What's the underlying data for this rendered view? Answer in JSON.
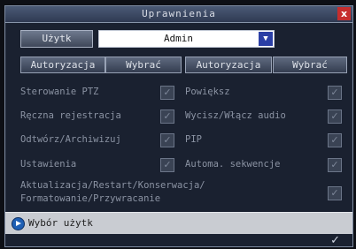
{
  "title": "Uprawnienia",
  "close_label": "x",
  "user": {
    "button_label": "Użytk",
    "selected": "Admin",
    "dropdown_arrow": "▼"
  },
  "header_buttons": [
    "Autoryzacja",
    "Wybrać",
    "Autoryzacja",
    "Wybrać"
  ],
  "permissions_left": [
    {
      "label": "Sterowanie PTZ",
      "checked": true
    },
    {
      "label": "Ręczna rejestracja",
      "checked": true
    },
    {
      "label": "Odtwórz/Archiwizuj",
      "checked": true
    },
    {
      "label": "Ustawienia",
      "checked": true
    }
  ],
  "permissions_right": [
    {
      "label": "Powiększ",
      "checked": true
    },
    {
      "label": "Wycisz/Włącz audio",
      "checked": true
    },
    {
      "label": "PIP",
      "checked": true
    },
    {
      "label": "Automa. sekwencje",
      "checked": true
    }
  ],
  "maintenance": {
    "line1": "Aktualizacja/Restart/Konserwacja/",
    "line2": "Formatowanie/Przywracanie",
    "checked": true
  },
  "checkmark": "✓",
  "status": {
    "text": "Wybór użytk",
    "icon": "info-arrow-icon"
  },
  "ok_label": "✓"
}
